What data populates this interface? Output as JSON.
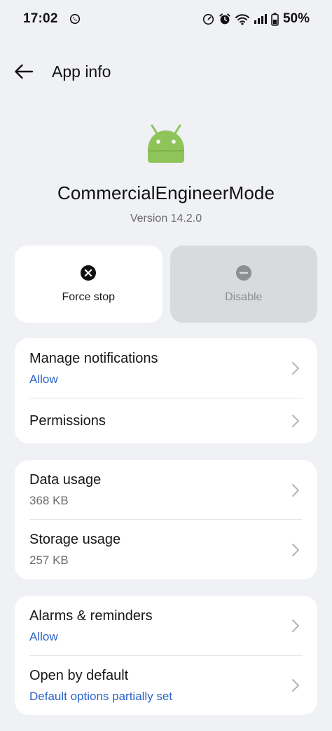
{
  "status_bar": {
    "time": "17:02",
    "battery": "50%",
    "icons": [
      "whatsapp-icon",
      "gauge-icon",
      "alarm-icon",
      "wifi-icon",
      "signal-icon",
      "battery-icon"
    ]
  },
  "header": {
    "title": "App info",
    "back_icon": "arrow-left-icon"
  },
  "app": {
    "name": "CommercialEngineerMode",
    "version": "Version 14.2.0",
    "icon": "android-robot-icon",
    "icon_color": "#8ec45a"
  },
  "actions": {
    "force_stop": {
      "label": "Force stop",
      "icon": "close-circle-icon"
    },
    "disable": {
      "label": "Disable",
      "icon": "minus-circle-icon",
      "enabled": false
    }
  },
  "sections": {
    "notifications": {
      "manage_title": "Manage notifications",
      "manage_value": "Allow",
      "permissions_title": "Permissions"
    },
    "usage": {
      "data_title": "Data usage",
      "data_value": "368 KB",
      "storage_title": "Storage usage",
      "storage_value": "257 KB"
    },
    "defaults": {
      "alarms_title": "Alarms & reminders",
      "alarms_value": "Allow",
      "open_title": "Open by default",
      "open_value": "Default options partially set"
    }
  },
  "colors": {
    "background": "#f0f1f5",
    "card": "#ffffff",
    "link": "#2b63c9",
    "disabled_button": "#d9dadd"
  }
}
